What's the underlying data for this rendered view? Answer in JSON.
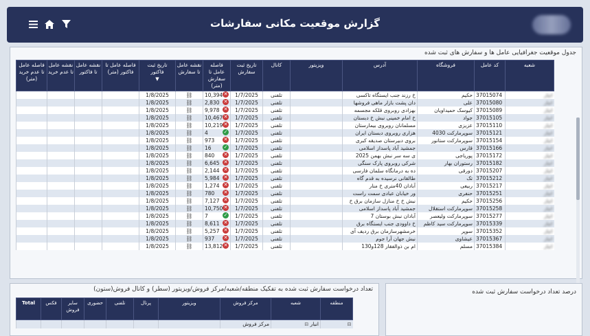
{
  "header": {
    "title": "گزارش موقعیت مکانی سفارشات",
    "filter_icon": "filter-icon",
    "home_icon": "home-icon",
    "menu_icon": "menu-icon"
  },
  "main_table": {
    "title": "جدول موقعیت جغرافیایی عامل ها و سفارش های ثبت شده",
    "headers": {
      "branch": "شعبه",
      "code": "کد عامل",
      "store": "فروشگاه",
      "address": "آدرس",
      "visitor": "ویزیتور",
      "channel": "کانال",
      "order_date": "تاریخ ثبت سفارش",
      "dist_order": "فاصله عامل تا سفارش (متر)",
      "map_order": "نقشه عامل تا سفارش",
      "invoice_date": "تاریخ ثبت فاکتور",
      "dist_invoice": "فاصله عامل تا فاکتور (متر)",
      "map_invoice": "نقشه عامل تا فاکتور",
      "map_nopurchase": "نقشه عامل تا عدم خرید",
      "dist_nopurchase": "فاصله عامل تا عدم خرید (متر)"
    },
    "rows": [
      {
        "branch": "انبار",
        "code": "37015074",
        "store": "حکیم",
        "address": "خ رزند جنب ایستگاه تاکسی",
        "visitor": "",
        "channel": "تلفنی",
        "order_date": "1/7/2025",
        "dist": "10,394",
        "status": "bad",
        "invoice_date": "1/8/2025"
      },
      {
        "branch": "انبار",
        "code": "37015080",
        "store": "علی",
        "address": "دان پشت بازار ماهی فروشها",
        "visitor": "",
        "channel": "تلفنی",
        "order_date": "1/7/2025",
        "dist": "2,830",
        "status": "bad",
        "invoice_date": "1/8/2025"
      },
      {
        "branch": "انبار",
        "code": "37015089",
        "store": "کیوسک حمیداویان",
        "address": "بهزادی روبروی قلکه مجسمه",
        "visitor": "",
        "channel": "تلفنی",
        "order_date": "1/7/2025",
        "dist": "9,978",
        "status": "bad",
        "invoice_date": "1/8/2025"
      },
      {
        "branch": "انبار",
        "code": "37015105",
        "store": "جواد",
        "address": "خ امام خمینی نبش خ دبستان",
        "visitor": "",
        "channel": "تلفنی",
        "order_date": "1/7/2025",
        "dist": "10,467",
        "status": "bad",
        "invoice_date": "1/8/2025"
      },
      {
        "branch": "انبار",
        "code": "37015110",
        "store": "عزیزی",
        "address": "مسلمانان روبروی بیمارستان",
        "visitor": "",
        "channel": "تلفنی",
        "order_date": "1/7/2025",
        "dist": "10,219",
        "status": "bad",
        "invoice_date": "1/8/2025"
      },
      {
        "branch": "انبار",
        "code": "37015121",
        "store": "سوپرمارکت 4030",
        "address": "هزاری روبروی دبستان ایران",
        "visitor": "",
        "channel": "تلفنی",
        "order_date": "1/7/2025",
        "dist": "4",
        "status": "good",
        "invoice_date": "1/8/2025"
      },
      {
        "branch": "انبار",
        "code": "37015154",
        "store": "سوپرمارکت ستانور",
        "address": "بروی دبیرستان صدیقه کبری",
        "visitor": "",
        "channel": "تلفنی",
        "order_date": "1/7/2025",
        "dist": "973",
        "status": "bad",
        "invoice_date": "1/8/2025"
      },
      {
        "branch": "انبار",
        "code": "37015166",
        "store": "قارس",
        "address": "جمشید آباد پاسداز اسلامی",
        "visitor": "",
        "channel": "تلفنی",
        "order_date": "1/7/2025",
        "dist": "16",
        "status": "good",
        "invoice_date": "1/8/2025"
      },
      {
        "branch": "انبار",
        "code": "37015172",
        "store": "پوریاجی",
        "address": "ی سه سر نبش بهمن 2025",
        "visitor": "",
        "channel": "تلفنی",
        "order_date": "1/7/2025",
        "dist": "840",
        "status": "bad",
        "invoice_date": "1/8/2025"
      },
      {
        "branch": "انبار",
        "code": "37015182",
        "store": "رستوران بهار",
        "address": "شرکی روبروی پارک سنگی",
        "visitor": "",
        "channel": "تلفنی",
        "order_date": "1/7/2025",
        "dist": "6,645",
        "status": "bad",
        "invoice_date": "1/8/2025"
      },
      {
        "branch": "انبار",
        "code": "37015207",
        "store": "دورقی",
        "address": "ده به درمانگاه سلمان فارسی",
        "visitor": "",
        "channel": "تلفنی",
        "order_date": "1/7/2025",
        "dist": "2,144",
        "status": "bad",
        "invoice_date": "1/8/2025"
      },
      {
        "branch": "انبار",
        "code": "37015212",
        "store": "تک",
        "address": "طالقانی نرسیده به قدم گاه",
        "visitor": "",
        "channel": "تلفنی",
        "order_date": "1/7/2025",
        "dist": "5,984",
        "status": "bad",
        "invoice_date": "1/8/2025"
      },
      {
        "branch": "انبار",
        "code": "37015217",
        "store": "ربیعی",
        "address": "آبادان 40متری خ منار",
        "visitor": "",
        "channel": "تلفنی",
        "order_date": "1/7/2025",
        "dist": "1,274",
        "status": "bad",
        "invoice_date": "1/8/2025"
      },
      {
        "branch": "انبار",
        "code": "37015251",
        "store": "حنفری",
        "address": "ور خیابان عبادی سمت راست",
        "visitor": "",
        "channel": "تلفنی",
        "order_date": "1/7/2025",
        "dist": "780",
        "status": "bad",
        "invoice_date": "1/8/2025"
      },
      {
        "branch": "انبار",
        "code": "37015256",
        "store": "حکیم",
        "address": "نبش خ خ منازل سازمان برق خ",
        "visitor": "",
        "channel": "تلفنی",
        "order_date": "1/7/2025",
        "dist": "7,127",
        "status": "bad",
        "invoice_date": "1/8/2025"
      },
      {
        "branch": "انبار",
        "code": "37015258",
        "store": "سوپرمارکت استقلال",
        "address": "جمشید آباد پاسداز اسلامی",
        "visitor": "",
        "channel": "تلفنی",
        "order_date": "1/7/2025",
        "dist": "10,750",
        "status": "bad",
        "invoice_date": "1/8/2025"
      },
      {
        "branch": "انبار",
        "code": "37015277",
        "store": "سوپرمارکت ولیعصر",
        "address": "آبادان نبش بوستان 7",
        "visitor": "",
        "channel": "تلفنی",
        "order_date": "1/7/2025",
        "dist": "7",
        "status": "good",
        "invoice_date": "1/8/2025"
      },
      {
        "branch": "انبار",
        "code": "37015339",
        "store": "سوپرمارکت سید کاظم",
        "address": "خ داوودی جنب ایستگاه برق",
        "visitor": "",
        "channel": "تلفنی",
        "order_date": "1/7/2025",
        "dist": "8,611",
        "status": "bad",
        "invoice_date": "1/8/2025"
      },
      {
        "branch": "انبار",
        "code": "37015352",
        "store": "سوپر",
        "address": "خرمشهرسازمان برق ردیف آی",
        "visitor": "",
        "channel": "تلفنی",
        "order_date": "1/7/2025",
        "dist": "5,257",
        "status": "bad",
        "invoice_date": "1/8/2025"
      },
      {
        "branch": "انبار",
        "code": "37015367",
        "store": "عیشاوی",
        "address": "نبش جهان آرا جوم",
        "visitor": "",
        "channel": "تلفنی",
        "order_date": "1/7/2025",
        "dist": "937",
        "status": "bad",
        "invoice_date": "1/8/2025"
      },
      {
        "branch": "انبار",
        "code": "37015384",
        "store": "مسلم",
        "address": "ام بن ذوالفقار 128و130",
        "visitor": "",
        "channel": "تلفنی",
        "order_date": "1/7/2025",
        "dist": "13,812",
        "status": "bad",
        "invoice_date": "1/8/2025"
      }
    ]
  },
  "bottom_left": {
    "title": "تعداد درخواست سفارش ثبت شده به تفکیک منطقه/شعبه/مرکز فروش/ویزیتور (سطر) و کانال فروش(ستون)",
    "headers": {
      "region": "منطقه",
      "branch": "شعبه",
      "sales_center": "مرکز فروش",
      "visitor": "ویزیتور",
      "portal": "پرتال",
      "phone": "تلفنی",
      "inperson": "حضوری",
      "other_sales": "سایر فروش",
      "fax": "فکس",
      "total": "Total"
    },
    "row": {
      "branch": "انبار",
      "sales_center": "مرکز فروش"
    }
  },
  "bottom_right": {
    "title": "درصد تعداد درخواست سفارش ثبت شده"
  }
}
